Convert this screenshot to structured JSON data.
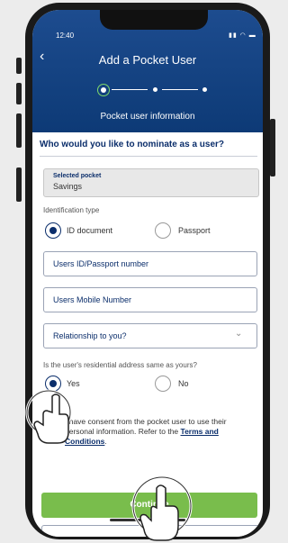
{
  "status": {
    "time": "12:40"
  },
  "header": {
    "title": "Add a Pocket User",
    "subtitle": "Pocket user information"
  },
  "form": {
    "question": "Who would you like to nominate as a user?",
    "selected_pocket": {
      "label": "Selected pocket",
      "value": "Savings"
    },
    "identification": {
      "label": "Identification type",
      "options": [
        {
          "label": "ID document",
          "selected": true
        },
        {
          "label": "Passport",
          "selected": false
        }
      ]
    },
    "id_placeholder": "Users ID/Passport number",
    "mobile_placeholder": "Users Mobile Number",
    "relationship_placeholder": "Relationship to you?",
    "residential": {
      "question": "Is the user's residential address same as yours?",
      "options": [
        {
          "label": "Yes",
          "selected": true
        },
        {
          "label": "No",
          "selected": false
        }
      ]
    },
    "consent": {
      "text": "I have consent from the pocket user to use their personal information. Refer to the ",
      "link": "Terms and Conditions",
      "end": "."
    },
    "continue_label": "Continue"
  },
  "colors": {
    "header": "#1d4c8f",
    "primary": "#0b2e6b",
    "continue": "#79bd4c",
    "step_active": "#7fd96a"
  },
  "icons": [
    "back-arrow-icon",
    "signal-icon",
    "wifi-icon",
    "battery-icon",
    "chevron-down-icon",
    "tap-hand-icon"
  ]
}
